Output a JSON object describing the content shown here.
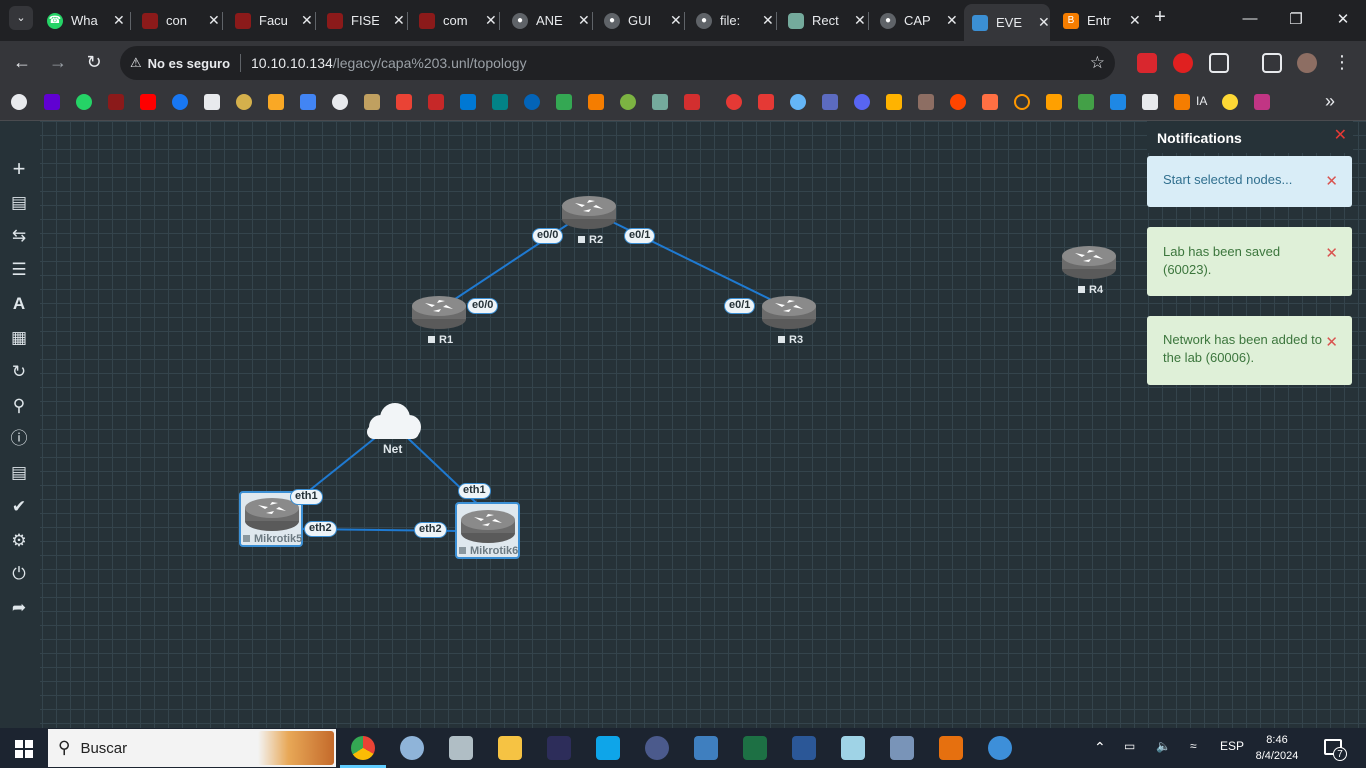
{
  "browser": {
    "tabs": [
      {
        "label": "Wha",
        "icon": "whatsapp-icon",
        "color": "#25d366"
      },
      {
        "label": "con",
        "icon": "shield-icon",
        "color": "#8b1a1a"
      },
      {
        "label": "Facu",
        "icon": "shield-icon",
        "color": "#8b1a1a"
      },
      {
        "label": "FISE",
        "icon": "shield-icon",
        "color": "#8b1a1a"
      },
      {
        "label": "com",
        "icon": "shield-icon",
        "color": "#8b1a1a"
      },
      {
        "label": "ANE",
        "icon": "globe-icon",
        "color": "#5f6368"
      },
      {
        "label": "GUI",
        "icon": "globe-icon",
        "color": "#5f6368"
      },
      {
        "label": "file:",
        "icon": "globe-icon",
        "color": "#5f6368"
      },
      {
        "label": "Rect",
        "icon": "chatgpt-icon",
        "color": "#74aa9c"
      },
      {
        "label": "CAP",
        "icon": "globe-icon",
        "color": "#5f6368"
      },
      {
        "label": "EVE",
        "icon": "eve-icon",
        "color": "#3b8fd4"
      },
      {
        "label": "Entr",
        "icon": "blogger-icon",
        "color": "#f57d00"
      }
    ],
    "active_tab": "EVE",
    "security_label": "No es seguro",
    "url_host": "10.10.10.134",
    "url_path": "/legacy/capa%203.unl/topology",
    "bookmark_label": "IA"
  },
  "topology": {
    "routers": [
      {
        "name": "R1"
      },
      {
        "name": "R2"
      },
      {
        "name": "R3"
      },
      {
        "name": "R4"
      }
    ],
    "mikrotiks": [
      {
        "name": "Mikrotik5"
      },
      {
        "name": "Mikrotik6"
      }
    ],
    "cloud": {
      "name": "Net"
    },
    "interfaces": {
      "r2_e00": "e0/0",
      "r2_e01": "e0/1",
      "r1_e00": "e0/0",
      "r3_e01": "e0/1",
      "mk5_eth1": "eth1",
      "mk5_eth2": "eth2",
      "mk6_eth1": "eth1",
      "mk6_eth2": "eth2"
    }
  },
  "notifications": {
    "title": "Notifications",
    "items": [
      {
        "text": "Start selected nodes...",
        "type": "info"
      },
      {
        "text": "Lab has been saved (60023).",
        "type": "success"
      },
      {
        "text": "Network has been added to the lab (60006).",
        "type": "success"
      }
    ]
  },
  "taskbar": {
    "search_placeholder": "Buscar",
    "language": "ESP",
    "time": "8:46",
    "date": "8/4/2024",
    "notification_count": "7"
  },
  "colors": {
    "workspace_bg": "#263238",
    "link": "#3b8fd4",
    "router_body": "#6b6b6b"
  }
}
